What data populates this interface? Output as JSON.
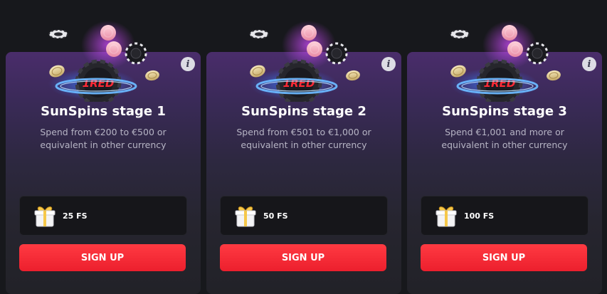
{
  "cards": [
    {
      "title": "SunSpins stage 1",
      "description": "Spend from €200 to €500 or equivalent in other currency",
      "reward": "25 FS",
      "button": "SIGN UP"
    },
    {
      "title": "SunSpins stage 2",
      "description": "Spend from €501 to €1,000 or equivalent in other currency",
      "reward": "50 FS",
      "button": "SIGN UP"
    },
    {
      "title": "SunSpins stage 3",
      "description": "Spend €1,001 and more or equivalent in other currency",
      "reward": "100 FS",
      "button": "SIGN UP"
    }
  ],
  "icons": {
    "info": "info-icon",
    "gift": "gift-icon",
    "hero": "casino-chips-coins-illustration"
  },
  "logo_text": "1RED",
  "colors": {
    "accent": "#f0232f",
    "page_bg": "#17181c",
    "card_top": "#4a2d6b",
    "card_bottom": "#222228",
    "reward_bg": "#16161a"
  }
}
